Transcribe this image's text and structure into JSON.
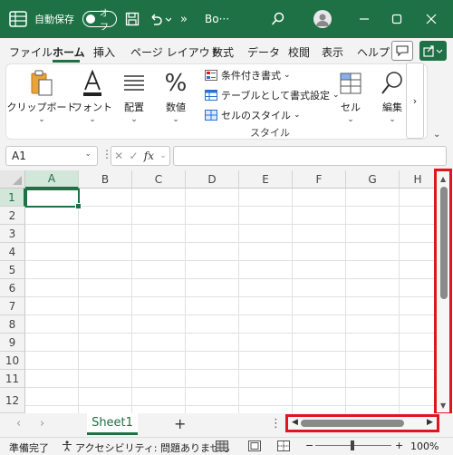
{
  "titlebar": {
    "autosave_label": "自動保存",
    "toggle_label": "オフ",
    "more": "»",
    "doc_name": "Bo···"
  },
  "ribbon_tabs": [
    "ファイル",
    "ホーム",
    "挿入",
    "ページ レイアウト",
    "数式",
    "データ",
    "校閲",
    "表示",
    "ヘルプ"
  ],
  "ribbon": {
    "clipboard": "クリップボード",
    "font": "フォント",
    "alignment": "配置",
    "number": "数値",
    "style_items": [
      "条件付き書式",
      "テーブルとして書式設定",
      "セルのスタイル"
    ],
    "style_group": "スタイル",
    "cells": "セル",
    "editing": "編集",
    "more": "›"
  },
  "formula_bar": {
    "name_box": "A1",
    "fx": "fx",
    "formula_value": ""
  },
  "grid": {
    "columns": [
      "A",
      "B",
      "C",
      "D",
      "E",
      "F",
      "G",
      "H"
    ],
    "rows": [
      "1",
      "2",
      "3",
      "4",
      "5",
      "6",
      "7",
      "8",
      "9",
      "10",
      "11",
      "12"
    ],
    "active_cell": "A1"
  },
  "sheet_bar": {
    "prev": "‹",
    "next": "›",
    "sheet_name": "Sheet1",
    "add": "+",
    "dots": "⋮"
  },
  "status_bar": {
    "ready": "準備完了",
    "accessibility": "アクセシビリティ: 問題ありません",
    "zoom": "100%",
    "zoom_minus": "−",
    "zoom_plus": "+"
  },
  "colors": {
    "accent": "#1e7145",
    "highlight": "#e0161e"
  }
}
